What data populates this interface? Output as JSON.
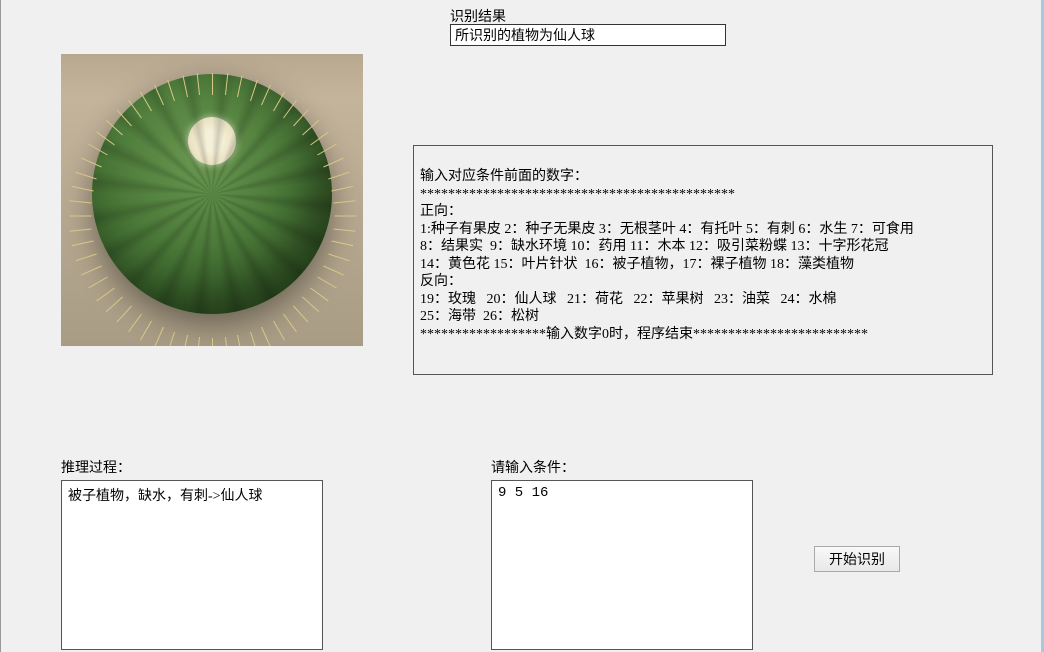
{
  "result": {
    "label": "识别结果",
    "value": "所识别的植物为仙人球"
  },
  "image": {
    "description": "cactus-plant-image"
  },
  "instructions": {
    "text": "输入对应条件前面的数字：\n*********************************************\n正向：\n1:种子有果皮 2：种子无果皮 3：无根茎叶 4：有托叶 5：有刺 6：水生 7：可食用\n8：结果实  9：缺水环境 10：药用 11：木本 12：吸引菜粉蝶 13：十字形花冠\n14：黄色花 15：叶片针状  16：被子植物，17：裸子植物 18：藻类植物\n反向：\n19：玫瑰   20：仙人球   21：荷花   22：苹果树   23：油菜   24：水棉\n25：海带  26：松树\n******************输入数字0时，程序结束*************************"
  },
  "reasoning": {
    "label": "推理过程：",
    "value": "被子植物，缺水，有刺->仙人球"
  },
  "conditionInput": {
    "label": "请输入条件：",
    "value": "9 5 16"
  },
  "button": {
    "label": "开始识别"
  }
}
